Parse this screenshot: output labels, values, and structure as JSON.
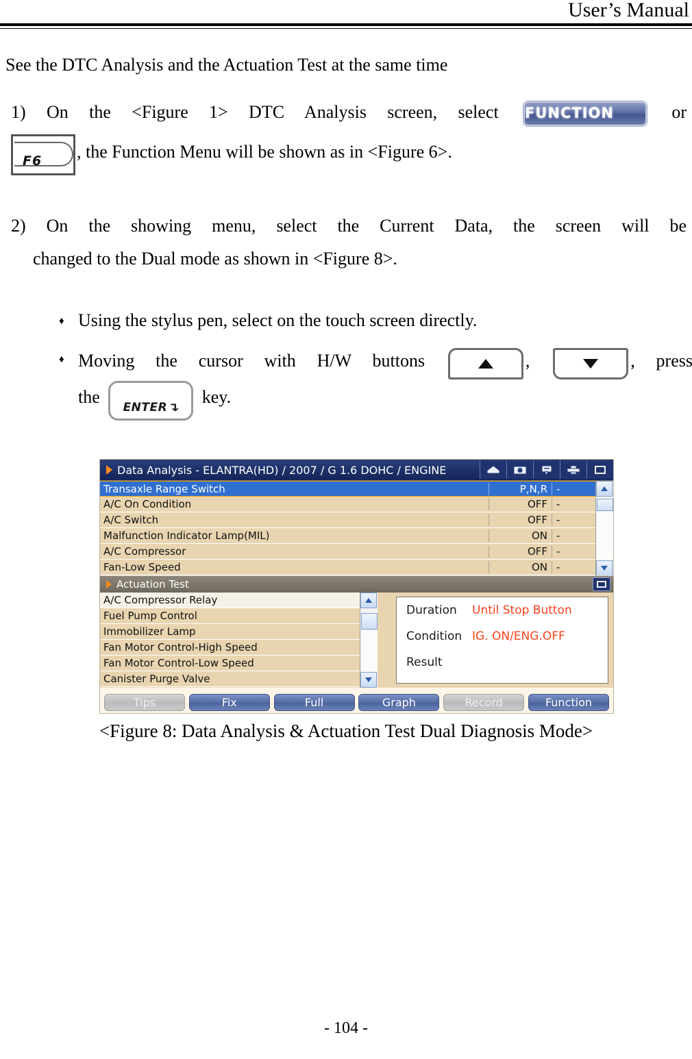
{
  "header": {
    "running_title": "User’s Manual"
  },
  "intro": {
    "text": "See the DTC Analysis and the Actuation Test at the same time"
  },
  "steps": [
    {
      "number": "1)",
      "text_before": "On the <Figure 1> DTC Analysis screen, select",
      "button_label": "FUNCTION",
      "text_or": "or",
      "key_label": "F6",
      "text_after": ", the Function Menu will be shown as in <Figure 6>."
    },
    {
      "number": "2)",
      "line1": "On the showing menu, select the Current Data, the screen will be",
      "line2": "changed to the Dual mode as shown in <Figure 8>."
    }
  ],
  "bullets": [
    {
      "marker": "♦",
      "text": "Using the stylus pen, select on the touch screen directly."
    },
    {
      "marker": "♦",
      "text_before": "Moving the cursor with H/W buttons",
      "key_up": "▲",
      "comma1": ",",
      "key_down": "▼",
      "text_mid": ", press",
      "text_the": "the",
      "key_enter": "ENTER",
      "text_after": "key."
    }
  ],
  "device": {
    "titlebar": {
      "title": "Data Analysis - ELANTRA(HD) / 2007 / G 1.6 DOHC / ENGINE",
      "icons": [
        "home-icon",
        "camera-icon",
        "help-balloon-icon",
        "printer-icon",
        "window-icon"
      ]
    },
    "data_table": {
      "rows": [
        {
          "name": "Transaxle Range Switch",
          "value": "P,N,R",
          "unit": "-",
          "selected": true
        },
        {
          "name": "A/C On Condition",
          "value": "OFF",
          "unit": "-",
          "selected": false
        },
        {
          "name": "A/C Switch",
          "value": "OFF",
          "unit": "-",
          "selected": false
        },
        {
          "name": "Malfunction Indicator Lamp(MIL)",
          "value": "ON",
          "unit": "-",
          "selected": false
        },
        {
          "name": "A/C Compressor",
          "value": "OFF",
          "unit": "-",
          "selected": false
        },
        {
          "name": "Fan-Low Speed",
          "value": "ON",
          "unit": "-",
          "selected": false
        }
      ]
    },
    "actuation": {
      "header_title": "Actuation Test",
      "items": [
        "A/C Compressor Relay",
        "Fuel Pump Control",
        "Immobilizer Lamp",
        "Fan Motor Control-High Speed",
        "Fan Motor Control-Low Speed",
        "Canister Purge Valve"
      ],
      "info": {
        "duration_label": "Duration",
        "duration_value": "Until Stop Button",
        "condition_label": "Condition",
        "condition_value": "IG. ON/ENG.OFF",
        "result_label": "Result",
        "result_value": ""
      }
    },
    "buttons": [
      {
        "label": "Tips",
        "enabled": false
      },
      {
        "label": "Fix",
        "enabled": true
      },
      {
        "label": "Full",
        "enabled": true
      },
      {
        "label": "Graph",
        "enabled": true
      },
      {
        "label": "Record",
        "enabled": false
      },
      {
        "label": "Function",
        "enabled": true
      }
    ],
    "colors": {
      "titlebar_blue": "#1d2f66",
      "row_tan": "#e8d5b0",
      "selected_blue": "#2f6fd0",
      "accent_orange": "#ff8a1e",
      "info_red": "#f4421c",
      "button_blue": "#5871a8",
      "button_gray": "#bcbcbc"
    }
  },
  "figure_caption": {
    "text": "<Figure 8: Data Analysis & Actuation Test Dual Diagnosis Mode>"
  },
  "footer": {
    "page_number": "- 104 -"
  }
}
